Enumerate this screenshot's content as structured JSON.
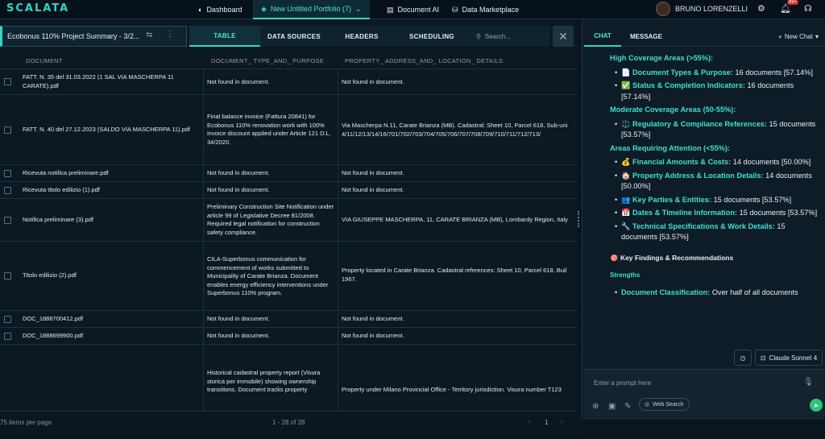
{
  "nav": {
    "logo": "SCALATA",
    "dashboard": "Dashboard",
    "portfolio": "New Untitled Portfolio (7)",
    "document_ai": "Document AI",
    "data_marketplace": "Data Marketplace",
    "user_name": "BRUNO LORENZELLI",
    "notification_count": "99+"
  },
  "left": {
    "project_title": "Ecobonus 110% Project Summary - 3/2...",
    "tabs": [
      "TABLE",
      "DATA SOURCES",
      "HEADERS",
      "SCHEDULING"
    ],
    "search_placeholder": "Search...",
    "columns": [
      "DOCUMENT",
      "DOCUMENT_ TYPE_AND_ PURPOSE",
      "PROPERTY_ ADDRESS_AND_ LOCATION_ DETAILS"
    ],
    "rows": [
      [
        "FATT. N. 35 del 31.03.2022 (1 SAL VIA MASCHERPA 11 CARATE).pdf",
        "Not found in document.",
        "Not found in document."
      ],
      [
        "FATT. N. 40 del 27.12.2023 (SALDO VIA MASCHERPA 11).pdf",
        "Final balance invoice (Fattura 20841) for Ecobonus 110% renovation work with 100% invoice discount applied under Article 121 D.L. 34/2020.",
        "Via Mascherpa N.11, Carate Brianza (MB). Cadastral: Sheet 10, Parcel 618, Sub-uni 4/11/12/13/14/16/701/702/703/704/705/706/707/708/709/710/711/712/713/"
      ],
      [
        "Ricevuta notifica preliminare.pdf",
        "Not found in document.",
        "Not found in document."
      ],
      [
        "Ricevuta titolo edilizio (1).pdf",
        "Not found in document.",
        "Not found in document."
      ],
      [
        "Notifica preliminare (3).pdf",
        "Preliminary Construction Site Notification under article 99 of Legislative Decree 81/2008. Required legal notification for construction safety compliance.",
        "VIA GIUSEPPE MASCHERPA, 11, CARATE BRIANZA (MB), Lombardy Region, Italy"
      ],
      [
        "Titolo edilizio (2).pdf",
        "CILA-Superbonus communication for commencement of works submitted to Municipality of Carate Brianza. Document enables energy efficiency interventions under Superbonus 110% program.",
        "Property located in Carate Brianza. Cadastral references: Sheet 10, Parcel 618. Buil 1967."
      ],
      [
        "DOC_1888700412.pdf",
        "Not found in document.",
        "Not found in document."
      ],
      [
        "DOC_1888699900.pdf",
        "Not found in document.",
        "Not found in document."
      ],
      [
        "",
        "Historical cadastral property report (Visura storica per immobile) showing ownership transitions. Document tracks property",
        "Property under Milano Provincial Office - Territory jurisdiction. Visura number T123"
      ]
    ],
    "footer_page_size": "75 items per page",
    "footer_range": "1 - 28 of 28",
    "footer_page": "1"
  },
  "right": {
    "tab_chat": "CHAT",
    "tab_message": "MESSAGE",
    "new_chat": "New Chat",
    "high_title": "High Coverage Areas (>55%):",
    "high_items": [
      {
        "icon": "📄",
        "label": "Document Types & Purpose:",
        "text": " 16 documents [57.14%]"
      },
      {
        "icon": "✅",
        "label": "Status & Completion Indicators:",
        "text": " 16 documents [57.14%]"
      }
    ],
    "mod_title": "Moderate Coverage Areas (50-55%):",
    "mod_items": [
      {
        "icon": "⚖️",
        "label": "Regulatory & Compliance References:",
        "text": " 15 documents [53.57%]"
      }
    ],
    "att_title": "Areas Requiring Attention (<55%):",
    "att_items": [
      {
        "icon": "💰",
        "label": "Financial Amounts & Costs:",
        "text": " 14 documents [50.00%]"
      },
      {
        "icon": "🏠",
        "label": "Property Address & Location Details:",
        "text": " 14 documents [50.00%]"
      },
      {
        "icon": "👥",
        "label": "Key Parties & Entities:",
        "text": " 15 documents [53.57%]"
      },
      {
        "icon": "📅",
        "label": "Dates & Timeline Information:",
        "text": " 15 documents [53.57%]"
      },
      {
        "icon": "🔧",
        "label": "Technical Specifications & Work Details:",
        "text": " 15 documents [53.57%]"
      }
    ],
    "findings_title": "🎯 Key Findings & Recommendations",
    "strengths": "Strengths",
    "strength_item_label": "Document Classification:",
    "strength_item_text": " Over half of all documents",
    "model": "Claude Sonnet 4",
    "prompt_placeholder": "Enter a prompt here",
    "web_search": "Web Search"
  }
}
